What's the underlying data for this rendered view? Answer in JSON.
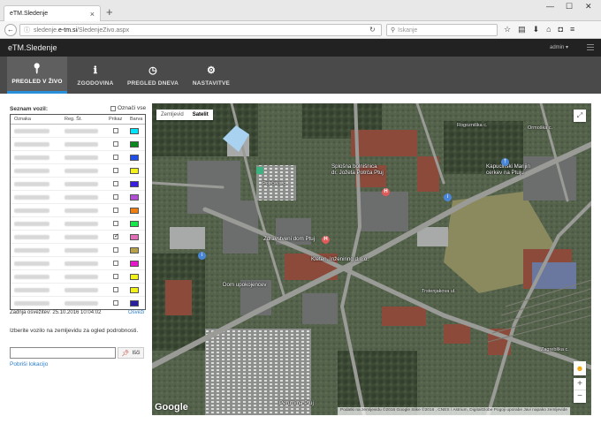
{
  "browser": {
    "tab_title": "eTM.Sledenje",
    "tab_close": "×",
    "new_tab": "+",
    "url_prefix": "sledenje.",
    "url_host": "e-tm.si",
    "url_path": "/SledenjeZivo.aspx",
    "search_placeholder": "Iskanje",
    "window_controls": [
      "—",
      "☐",
      "✕"
    ]
  },
  "app": {
    "brand": "eTM.Sledenje",
    "user": "admin ▾"
  },
  "nav": [
    {
      "label": "PREGLED V ŽIVO",
      "icon": "map-marker-icon",
      "active": true
    },
    {
      "label": "ZGODOVINA",
      "icon": "info-icon",
      "active": false
    },
    {
      "label": "PREGLED DNEVA",
      "icon": "clock-icon",
      "active": false
    },
    {
      "label": "NASTAVITVE",
      "icon": "gear-icon",
      "active": false
    }
  ],
  "vehicles": {
    "title": "Seznam vozil:",
    "select_all": "Označi vse",
    "columns": {
      "name": "Oznaka",
      "reg": "Reg. Št.",
      "show": "Prikaz",
      "color": "Barva"
    },
    "rows": [
      {
        "color": "#00e5ff",
        "checked": false
      },
      {
        "color": "#0a8a1e",
        "checked": false
      },
      {
        "color": "#1f4fe8",
        "checked": false
      },
      {
        "color": "#f2f21a",
        "checked": false
      },
      {
        "color": "#3b1fe0",
        "checked": false
      },
      {
        "color": "#b14fd6",
        "checked": false
      },
      {
        "color": "#f07f12",
        "checked": false
      },
      {
        "color": "#17e84a",
        "checked": false
      },
      {
        "color": "#e06fb8",
        "checked": true
      },
      {
        "color": "#b8a24a",
        "checked": false
      },
      {
        "color": "#e617c8",
        "checked": false
      },
      {
        "color": "#f2f21a",
        "checked": false
      },
      {
        "color": "#f2f21a",
        "checked": false
      },
      {
        "color": "#2a1fa0",
        "checked": false
      }
    ],
    "last_update": "Zadnja osvežitev: 25.10.2016 10:04:02",
    "refresh": "Osveži"
  },
  "location": {
    "hint": "Izberite vozilo na zemljevidu za ogled podrobnosti.",
    "search_button": "Išči",
    "clear_link": "Pobriši lokacijo"
  },
  "map": {
    "type_map": "Zemljevid",
    "type_sat": "Satelit",
    "google": "Google",
    "attribution": "Podatki na zemljevidu ©2016 Google Slike ©2016 , CNES / Astrium, DigitalGlobe   Pogoji uporabe   Javi napako zemljevide",
    "labels": {
      "hospital": "Splošna bolnišnica\ndr. Jožeta Potrča Ptuj",
      "health": "Zdravstveni dom Ptuj",
      "company": "Perutnina Ptuj",
      "company2": "Kleten. Inženiring d.o.o.",
      "home": "Dom upokojencev",
      "school": "Gimnazija Ptuj",
      "church": "Župnija Ptuj",
      "bolnica": "Bolnišnica",
      "trstenjak": "Trstenjakova ul.",
      "perutnina2": "Perutnina Ptuj",
      "marija": "Kapucinski Marijin\ncerkev na Ptuju",
      "rogoz": "Rogozniška c.",
      "ormoz": "Ormoška c.",
      "zagreb": "Zagrebška c.",
      "vicava": "Vičava",
      "potrceva": "Potrčeva c."
    }
  }
}
